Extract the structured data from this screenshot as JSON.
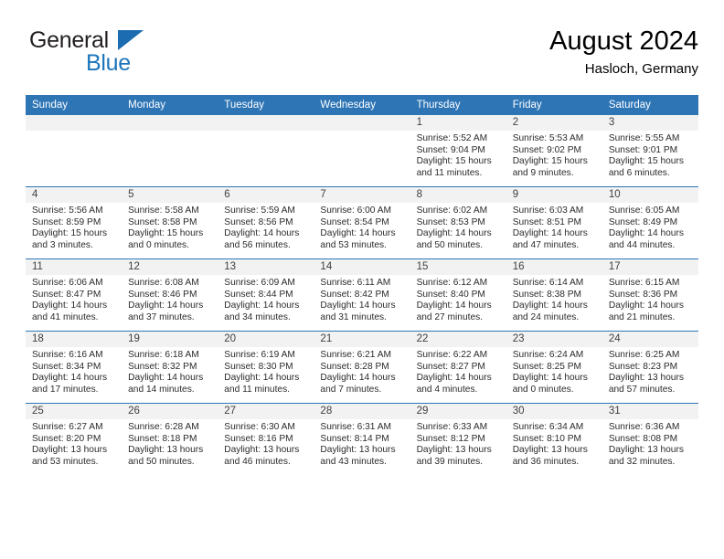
{
  "brand": {
    "line1": "General",
    "line2": "Blue",
    "accent_color": "#1b75bb",
    "triangle_color": "#1b6cb0"
  },
  "header": {
    "title": "August 2024",
    "location": "Hasloch, Germany"
  },
  "theme": {
    "header_bg": "#2e75b6",
    "header_text": "#ffffff",
    "daynum_bg": "#f2f2f2",
    "grid_line": "#2e75b6"
  },
  "weekday_headers": [
    "Sunday",
    "Monday",
    "Tuesday",
    "Wednesday",
    "Thursday",
    "Friday",
    "Saturday"
  ],
  "labels": {
    "sunrise_prefix": "Sunrise:",
    "sunset_prefix": "Sunset:",
    "daylight_prefix": "Daylight:"
  },
  "weeks": [
    [
      {
        "day": "",
        "sunrise": "",
        "sunset": "",
        "daylight_line1": "",
        "daylight_line2": ""
      },
      {
        "day": "",
        "sunrise": "",
        "sunset": "",
        "daylight_line1": "",
        "daylight_line2": ""
      },
      {
        "day": "",
        "sunrise": "",
        "sunset": "",
        "daylight_line1": "",
        "daylight_line2": ""
      },
      {
        "day": "",
        "sunrise": "",
        "sunset": "",
        "daylight_line1": "",
        "daylight_line2": ""
      },
      {
        "day": "1",
        "sunrise": "Sunrise: 5:52 AM",
        "sunset": "Sunset: 9:04 PM",
        "daylight_line1": "Daylight: 15 hours",
        "daylight_line2": "and 11 minutes."
      },
      {
        "day": "2",
        "sunrise": "Sunrise: 5:53 AM",
        "sunset": "Sunset: 9:02 PM",
        "daylight_line1": "Daylight: 15 hours",
        "daylight_line2": "and 9 minutes."
      },
      {
        "day": "3",
        "sunrise": "Sunrise: 5:55 AM",
        "sunset": "Sunset: 9:01 PM",
        "daylight_line1": "Daylight: 15 hours",
        "daylight_line2": "and 6 minutes."
      }
    ],
    [
      {
        "day": "4",
        "sunrise": "Sunrise: 5:56 AM",
        "sunset": "Sunset: 8:59 PM",
        "daylight_line1": "Daylight: 15 hours",
        "daylight_line2": "and 3 minutes."
      },
      {
        "day": "5",
        "sunrise": "Sunrise: 5:58 AM",
        "sunset": "Sunset: 8:58 PM",
        "daylight_line1": "Daylight: 15 hours",
        "daylight_line2": "and 0 minutes."
      },
      {
        "day": "6",
        "sunrise": "Sunrise: 5:59 AM",
        "sunset": "Sunset: 8:56 PM",
        "daylight_line1": "Daylight: 14 hours",
        "daylight_line2": "and 56 minutes."
      },
      {
        "day": "7",
        "sunrise": "Sunrise: 6:00 AM",
        "sunset": "Sunset: 8:54 PM",
        "daylight_line1": "Daylight: 14 hours",
        "daylight_line2": "and 53 minutes."
      },
      {
        "day": "8",
        "sunrise": "Sunrise: 6:02 AM",
        "sunset": "Sunset: 8:53 PM",
        "daylight_line1": "Daylight: 14 hours",
        "daylight_line2": "and 50 minutes."
      },
      {
        "day": "9",
        "sunrise": "Sunrise: 6:03 AM",
        "sunset": "Sunset: 8:51 PM",
        "daylight_line1": "Daylight: 14 hours",
        "daylight_line2": "and 47 minutes."
      },
      {
        "day": "10",
        "sunrise": "Sunrise: 6:05 AM",
        "sunset": "Sunset: 8:49 PM",
        "daylight_line1": "Daylight: 14 hours",
        "daylight_line2": "and 44 minutes."
      }
    ],
    [
      {
        "day": "11",
        "sunrise": "Sunrise: 6:06 AM",
        "sunset": "Sunset: 8:47 PM",
        "daylight_line1": "Daylight: 14 hours",
        "daylight_line2": "and 41 minutes."
      },
      {
        "day": "12",
        "sunrise": "Sunrise: 6:08 AM",
        "sunset": "Sunset: 8:46 PM",
        "daylight_line1": "Daylight: 14 hours",
        "daylight_line2": "and 37 minutes."
      },
      {
        "day": "13",
        "sunrise": "Sunrise: 6:09 AM",
        "sunset": "Sunset: 8:44 PM",
        "daylight_line1": "Daylight: 14 hours",
        "daylight_line2": "and 34 minutes."
      },
      {
        "day": "14",
        "sunrise": "Sunrise: 6:11 AM",
        "sunset": "Sunset: 8:42 PM",
        "daylight_line1": "Daylight: 14 hours",
        "daylight_line2": "and 31 minutes."
      },
      {
        "day": "15",
        "sunrise": "Sunrise: 6:12 AM",
        "sunset": "Sunset: 8:40 PM",
        "daylight_line1": "Daylight: 14 hours",
        "daylight_line2": "and 27 minutes."
      },
      {
        "day": "16",
        "sunrise": "Sunrise: 6:14 AM",
        "sunset": "Sunset: 8:38 PM",
        "daylight_line1": "Daylight: 14 hours",
        "daylight_line2": "and 24 minutes."
      },
      {
        "day": "17",
        "sunrise": "Sunrise: 6:15 AM",
        "sunset": "Sunset: 8:36 PM",
        "daylight_line1": "Daylight: 14 hours",
        "daylight_line2": "and 21 minutes."
      }
    ],
    [
      {
        "day": "18",
        "sunrise": "Sunrise: 6:16 AM",
        "sunset": "Sunset: 8:34 PM",
        "daylight_line1": "Daylight: 14 hours",
        "daylight_line2": "and 17 minutes."
      },
      {
        "day": "19",
        "sunrise": "Sunrise: 6:18 AM",
        "sunset": "Sunset: 8:32 PM",
        "daylight_line1": "Daylight: 14 hours",
        "daylight_line2": "and 14 minutes."
      },
      {
        "day": "20",
        "sunrise": "Sunrise: 6:19 AM",
        "sunset": "Sunset: 8:30 PM",
        "daylight_line1": "Daylight: 14 hours",
        "daylight_line2": "and 11 minutes."
      },
      {
        "day": "21",
        "sunrise": "Sunrise: 6:21 AM",
        "sunset": "Sunset: 8:28 PM",
        "daylight_line1": "Daylight: 14 hours",
        "daylight_line2": "and 7 minutes."
      },
      {
        "day": "22",
        "sunrise": "Sunrise: 6:22 AM",
        "sunset": "Sunset: 8:27 PM",
        "daylight_line1": "Daylight: 14 hours",
        "daylight_line2": "and 4 minutes."
      },
      {
        "day": "23",
        "sunrise": "Sunrise: 6:24 AM",
        "sunset": "Sunset: 8:25 PM",
        "daylight_line1": "Daylight: 14 hours",
        "daylight_line2": "and 0 minutes."
      },
      {
        "day": "24",
        "sunrise": "Sunrise: 6:25 AM",
        "sunset": "Sunset: 8:23 PM",
        "daylight_line1": "Daylight: 13 hours",
        "daylight_line2": "and 57 minutes."
      }
    ],
    [
      {
        "day": "25",
        "sunrise": "Sunrise: 6:27 AM",
        "sunset": "Sunset: 8:20 PM",
        "daylight_line1": "Daylight: 13 hours",
        "daylight_line2": "and 53 minutes."
      },
      {
        "day": "26",
        "sunrise": "Sunrise: 6:28 AM",
        "sunset": "Sunset: 8:18 PM",
        "daylight_line1": "Daylight: 13 hours",
        "daylight_line2": "and 50 minutes."
      },
      {
        "day": "27",
        "sunrise": "Sunrise: 6:30 AM",
        "sunset": "Sunset: 8:16 PM",
        "daylight_line1": "Daylight: 13 hours",
        "daylight_line2": "and 46 minutes."
      },
      {
        "day": "28",
        "sunrise": "Sunrise: 6:31 AM",
        "sunset": "Sunset: 8:14 PM",
        "daylight_line1": "Daylight: 13 hours",
        "daylight_line2": "and 43 minutes."
      },
      {
        "day": "29",
        "sunrise": "Sunrise: 6:33 AM",
        "sunset": "Sunset: 8:12 PM",
        "daylight_line1": "Daylight: 13 hours",
        "daylight_line2": "and 39 minutes."
      },
      {
        "day": "30",
        "sunrise": "Sunrise: 6:34 AM",
        "sunset": "Sunset: 8:10 PM",
        "daylight_line1": "Daylight: 13 hours",
        "daylight_line2": "and 36 minutes."
      },
      {
        "day": "31",
        "sunrise": "Sunrise: 6:36 AM",
        "sunset": "Sunset: 8:08 PM",
        "daylight_line1": "Daylight: 13 hours",
        "daylight_line2": "and 32 minutes."
      }
    ]
  ]
}
